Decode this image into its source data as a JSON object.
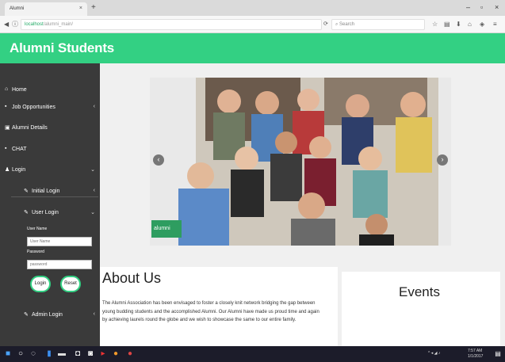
{
  "browser": {
    "tab_title": "Alumni",
    "tab_close": "×",
    "new_tab": "+",
    "window_controls": [
      "–",
      "▫",
      "×"
    ],
    "url_host": "localhost",
    "url_path": "/alumni_main/",
    "search_placeholder": "Search"
  },
  "site": {
    "title": "Alumni Students"
  },
  "sidebar": {
    "items": [
      {
        "label": "Home",
        "icon": "home-icon",
        "chevron": ""
      },
      {
        "label": "Job Opportunities",
        "icon": "briefcase-icon",
        "chevron": "‹"
      },
      {
        "label": "Alumni Details",
        "icon": "id-card-icon",
        "chevron": ""
      },
      {
        "label": "CHAT",
        "icon": "chat-icon",
        "chevron": ""
      },
      {
        "label": "Login",
        "icon": "user-icon",
        "chevron": "⌄"
      },
      {
        "label": "Initial Login",
        "icon": "pencil-icon",
        "chevron": "‹"
      },
      {
        "label": "User Login",
        "icon": "pencil-icon",
        "chevron": "⌄"
      },
      {
        "label": "Admin Login",
        "icon": "pencil-icon",
        "chevron": "‹"
      }
    ],
    "login_form": {
      "username_label": "User Name",
      "username_placeholder": "User Name",
      "password_label": "Password",
      "password_placeholder": "password",
      "login_button": "Login",
      "reset_button": "Reset"
    }
  },
  "carousel": {
    "caption": "alumni",
    "prev": "‹",
    "next": "›"
  },
  "about": {
    "title": "About Us",
    "text": "The Alumni Association has been envisaged to foster a closely knit network bridging the gap between young budding students and the accomplished Alumni. Our Alumni have made us proud time and again by achieving laurels round the globe and we wish to showcase the same to our entire family."
  },
  "events": {
    "title": "Events"
  },
  "taskbar": {
    "time": "7:57 AM",
    "date": "1/1/2017"
  },
  "colors": {
    "accent": "#33d083",
    "sidebar": "#3a3a3a",
    "taskbar": "#1c1c2a"
  }
}
